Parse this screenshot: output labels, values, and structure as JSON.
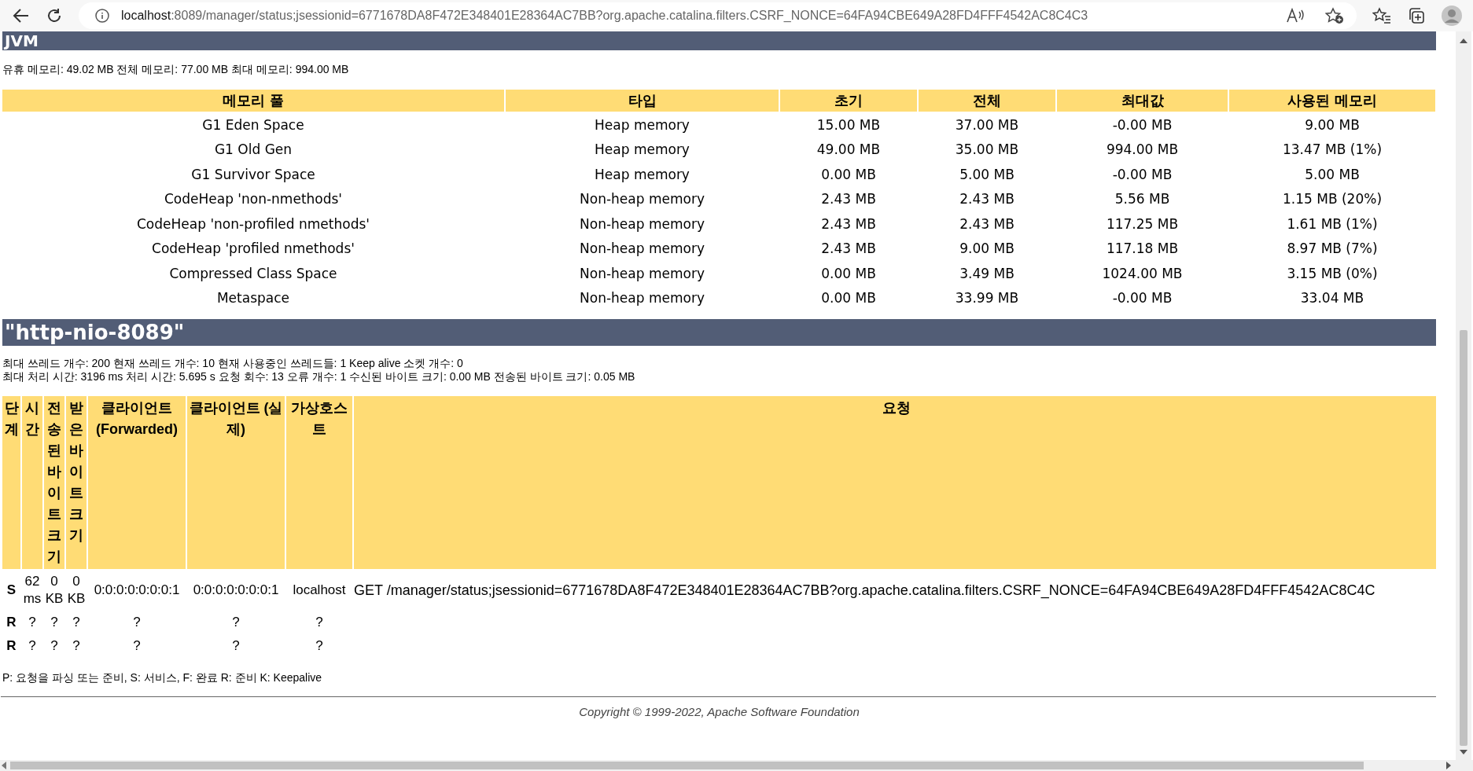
{
  "browser": {
    "url_host": "localhost",
    "url_rest": ":8089/manager/status;jsessionid=6771678DA8F472E348401E28364AC7BB?org.apache.catalina.filters.CSRF_NONCE=64FA94CBE649A28FD4FFF4542AC8C4C3"
  },
  "jvm": {
    "title": "JVM",
    "summary": "유휴 메모리: 49.02 MB 전체 메모리: 77.00 MB 최대 메모리: 994.00 MB",
    "columns": [
      "메모리 풀",
      "타입",
      "초기",
      "전체",
      "최대값",
      "사용된 메모리"
    ],
    "rows": [
      [
        "G1 Eden Space",
        "Heap memory",
        "15.00 MB",
        "37.00 MB",
        "-0.00 MB",
        "9.00 MB"
      ],
      [
        "G1 Old Gen",
        "Heap memory",
        "49.00 MB",
        "35.00 MB",
        "994.00 MB",
        "13.47 MB (1%)"
      ],
      [
        "G1 Survivor Space",
        "Heap memory",
        "0.00 MB",
        "5.00 MB",
        "-0.00 MB",
        "5.00 MB"
      ],
      [
        "CodeHeap 'non-nmethods'",
        "Non-heap memory",
        "2.43 MB",
        "2.43 MB",
        "5.56 MB",
        "1.15 MB (20%)"
      ],
      [
        "CodeHeap 'non-profiled nmethods'",
        "Non-heap memory",
        "2.43 MB",
        "2.43 MB",
        "117.25 MB",
        "1.61 MB (1%)"
      ],
      [
        "CodeHeap 'profiled nmethods'",
        "Non-heap memory",
        "2.43 MB",
        "9.00 MB",
        "117.18 MB",
        "8.97 MB (7%)"
      ],
      [
        "Compressed Class Space",
        "Non-heap memory",
        "0.00 MB",
        "3.49 MB",
        "1024.00 MB",
        "3.15 MB (0%)"
      ],
      [
        "Metaspace",
        "Non-heap memory",
        "0.00 MB",
        "33.99 MB",
        "-0.00 MB",
        "33.04 MB"
      ]
    ]
  },
  "connector": {
    "title": "\"http-nio-8089\"",
    "stats": [
      "최대 쓰레드 개수: 200 현재 쓰레드 개수: 10 현재 사용중인 쓰레드들: 1 Keep alive 소켓 개수: 0",
      "최대 처리 시간: 3196 ms 처리 시간: 5.695 s 요청 회수: 13 오류 개수: 1 수신된 바이트 크기: 0.00 MB 전송된 바이트 크기: 0.05 MB"
    ],
    "columns": [
      "단계",
      "시간",
      "전송된바이트크기",
      "받은바이트크기",
      "클라이언트 (Forwarded)",
      "클라이언트 (실제)",
      "가상호스트",
      "요청"
    ],
    "rows": [
      {
        "cells": [
          "S",
          "62 ms",
          "0 KB",
          "0 KB",
          "0:0:0:0:0:0:0:1",
          "0:0:0:0:0:0:0:1",
          "localhost",
          "GET /manager/status;jsessionid=6771678DA8F472E348401E28364AC7BB?org.apache.catalina.filters.CSRF_NONCE=64FA94CBE649A28FD4FFF4542AC8C4C"
        ]
      },
      {
        "cells": [
          "R",
          "?",
          "?",
          "?",
          "?",
          "?",
          "?"
        ]
      },
      {
        "cells": [
          "R",
          "?",
          "?",
          "?",
          "?",
          "?",
          "?"
        ]
      }
    ],
    "legend": "P: 요청을 파싱 또는 준비, S: 서비스, F: 완료 R: 준비 K: Keepalive"
  },
  "footer": {
    "copyright": "Copyright © 1999-2022, Apache Software Foundation"
  }
}
